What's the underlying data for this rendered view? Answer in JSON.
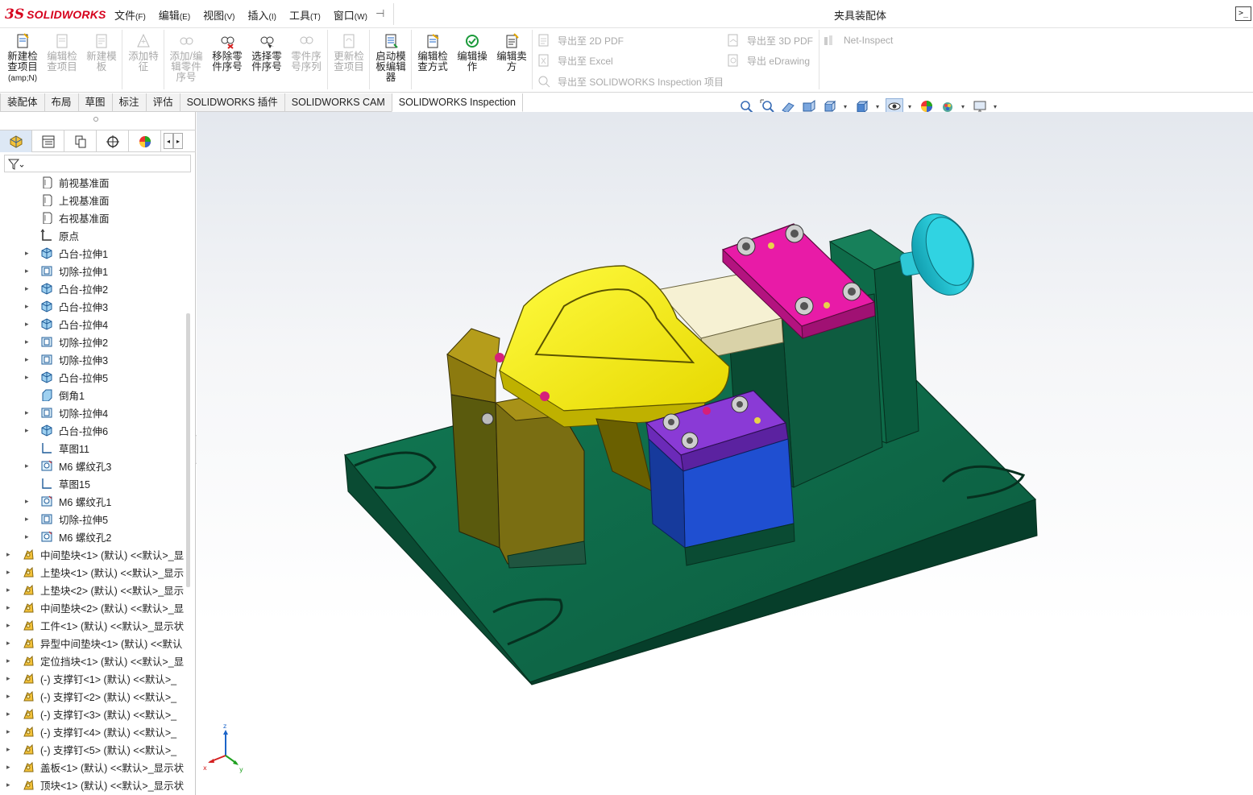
{
  "app": {
    "brand_ds": "3S",
    "brand_name": "SOLIDWORKS",
    "document_title": "夹具装配体",
    "menus": [
      {
        "label": "文件",
        "key": "(F)"
      },
      {
        "label": "编辑",
        "key": "(E)"
      },
      {
        "label": "视图",
        "key": "(V)"
      },
      {
        "label": "插入",
        "key": "(I)"
      },
      {
        "label": "工具",
        "key": "(T)"
      },
      {
        "label": "窗口",
        "key": "(W)"
      }
    ],
    "pin_glyph": "⊣",
    "cmd_glyph": ">_"
  },
  "ribbon": {
    "buttons": [
      {
        "line1": "新建检",
        "line2": "查项目",
        "line3": "(amp;N)",
        "enabled": true
      },
      {
        "line1": "编辑检",
        "line2": "查项目",
        "line3": "",
        "enabled": false
      },
      {
        "line1": "新建模",
        "line2": "板",
        "line3": "",
        "enabled": false
      },
      {
        "line1": "添加特",
        "line2": "征",
        "line3": "",
        "enabled": false
      },
      {
        "line1": "添加/编",
        "line2": "辑零件",
        "line3": "序号",
        "enabled": false
      },
      {
        "line1": "移除零",
        "line2": "件序号",
        "line3": "",
        "enabled": true
      },
      {
        "line1": "选择零",
        "line2": "件序号",
        "line3": "",
        "enabled": true
      },
      {
        "line1": "零件序",
        "line2": "号序列",
        "line3": "",
        "enabled": false
      },
      {
        "line1": "更新检",
        "line2": "查项目",
        "line3": "",
        "enabled": false
      },
      {
        "line1": "启动模",
        "line2": "板编辑",
        "line3": "器",
        "enabled": true
      },
      {
        "line1": "编辑检",
        "line2": "查方式",
        "line3": "",
        "enabled": true
      },
      {
        "line1": "编辑操",
        "line2": "作",
        "line3": "",
        "enabled": true
      },
      {
        "line1": "编辑卖",
        "line2": "方",
        "line3": "",
        "enabled": true
      }
    ],
    "exports": {
      "pdf2d": "导出至 2D PDF",
      "excel": "导出至 Excel",
      "inspection": "导出至 SOLIDWORKS Inspection 项目",
      "pdf3d": "导出至 3D PDF",
      "edrawing": "导出 eDrawing",
      "netinspect": "Net-Inspect"
    }
  },
  "tabs": [
    "装配体",
    "布局",
    "草图",
    "标注",
    "评估",
    "SOLIDWORKS 插件",
    "SOLIDWORKS CAM",
    "SOLIDWORKS Inspection"
  ],
  "active_tab": 7,
  "tree": {
    "items": [
      {
        "label": "前视基准面",
        "type": "plane",
        "level": 1,
        "expandable": false
      },
      {
        "label": "上视基准面",
        "type": "plane",
        "level": 1,
        "expandable": false
      },
      {
        "label": "右视基准面",
        "type": "plane",
        "level": 1,
        "expandable": false
      },
      {
        "label": "原点",
        "type": "origin",
        "level": 1,
        "expandable": false
      },
      {
        "label": "凸台-拉伸1",
        "type": "boss",
        "level": 1,
        "expandable": true
      },
      {
        "label": "切除-拉伸1",
        "type": "cut",
        "level": 1,
        "expandable": true
      },
      {
        "label": "凸台-拉伸2",
        "type": "boss",
        "level": 1,
        "expandable": true
      },
      {
        "label": "凸台-拉伸3",
        "type": "boss",
        "level": 1,
        "expandable": true
      },
      {
        "label": "凸台-拉伸4",
        "type": "boss",
        "level": 1,
        "expandable": true
      },
      {
        "label": "切除-拉伸2",
        "type": "cut",
        "level": 1,
        "expandable": true
      },
      {
        "label": "切除-拉伸3",
        "type": "cut",
        "level": 1,
        "expandable": true
      },
      {
        "label": "凸台-拉伸5",
        "type": "boss",
        "level": 1,
        "expandable": true
      },
      {
        "label": "倒角1",
        "type": "chamfer",
        "level": 1,
        "expandable": false
      },
      {
        "label": "切除-拉伸4",
        "type": "cut",
        "level": 1,
        "expandable": true
      },
      {
        "label": "凸台-拉伸6",
        "type": "boss",
        "level": 1,
        "expandable": true
      },
      {
        "label": "草图11",
        "type": "sketch",
        "level": 1,
        "expandable": false
      },
      {
        "label": "M6 螺纹孔3",
        "type": "hole",
        "level": 1,
        "expandable": true
      },
      {
        "label": "草图15",
        "type": "sketch",
        "level": 1,
        "expandable": false
      },
      {
        "label": "M6 螺纹孔1",
        "type": "hole",
        "level": 1,
        "expandable": true
      },
      {
        "label": "切除-拉伸5",
        "type": "cut",
        "level": 1,
        "expandable": true
      },
      {
        "label": "M6 螺纹孔2",
        "type": "hole",
        "level": 1,
        "expandable": true
      },
      {
        "label": "中间垫块<1> (默认) <<默认>_显",
        "type": "part",
        "level": 0,
        "expandable": true
      },
      {
        "label": "上垫块<1> (默认) <<默认>_显示",
        "type": "part",
        "level": 0,
        "expandable": true
      },
      {
        "label": "上垫块<2> (默认) <<默认>_显示",
        "type": "part",
        "level": 0,
        "expandable": true
      },
      {
        "label": "中间垫块<2> (默认) <<默认>_显",
        "type": "part",
        "level": 0,
        "expandable": true
      },
      {
        "label": "工件<1> (默认) <<默认>_显示状",
        "type": "part",
        "level": 0,
        "expandable": true
      },
      {
        "label": "异型中间垫块<1> (默认) <<默认",
        "type": "part",
        "level": 0,
        "expandable": true
      },
      {
        "label": "定位挡块<1> (默认) <<默认>_显",
        "type": "part",
        "level": 0,
        "expandable": true
      },
      {
        "label": "(-) 支撑钉<1> (默认) <<默认>_",
        "type": "part",
        "level": 0,
        "expandable": true
      },
      {
        "label": "(-) 支撑钉<2> (默认) <<默认>_",
        "type": "part",
        "level": 0,
        "expandable": true
      },
      {
        "label": "(-) 支撑钉<3> (默认) <<默认>_",
        "type": "part",
        "level": 0,
        "expandable": true
      },
      {
        "label": "(-) 支撑钉<4> (默认) <<默认>_",
        "type": "part",
        "level": 0,
        "expandable": true
      },
      {
        "label": "(-) 支撑钉<5> (默认) <<默认>_",
        "type": "part",
        "level": 0,
        "expandable": true
      },
      {
        "label": "盖板<1> (默认) <<默认>_显示状",
        "type": "part",
        "level": 0,
        "expandable": true
      },
      {
        "label": "顶块<1> (默认) <<默认>_显示状",
        "type": "part",
        "level": 0,
        "expandable": true
      }
    ]
  },
  "triad": {
    "x": "x",
    "y": "y",
    "z": "z"
  },
  "colors": {
    "base": "#0f6b4c",
    "yellow_part": "#f4ef10",
    "magenta_plate": "#e61aa3",
    "purple_block": "#8a3ad6",
    "blue_block": "#1f4fd1",
    "olive_block": "#9c8a14",
    "cyan_knob": "#24c8d6",
    "cream_slider": "#f3efcf",
    "accent_blue": "#1b64c8"
  }
}
